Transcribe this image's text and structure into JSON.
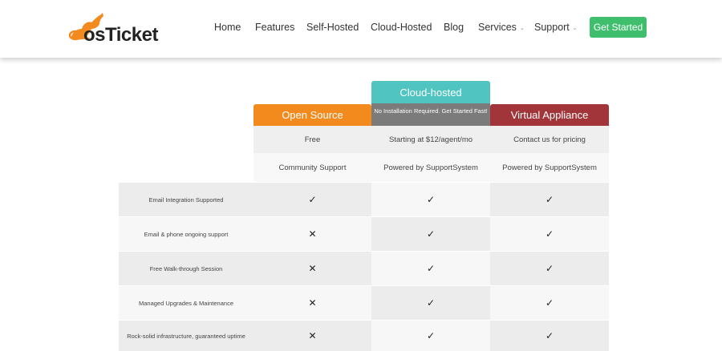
{
  "header": {
    "logo_text": "osTicket",
    "nav": [
      {
        "label": "Home"
      },
      {
        "label": "Features"
      },
      {
        "label": "Self-Hosted"
      },
      {
        "label": "Cloud-Hosted"
      },
      {
        "label": "Blog"
      },
      {
        "label": "Services",
        "dropdown": true
      },
      {
        "label": "Support",
        "dropdown": true
      }
    ],
    "cta_label": "Get Started"
  },
  "pricing": {
    "columns": [
      {
        "title": "Open Source",
        "price": "Free",
        "support": "Community Support",
        "color": "#f28a1e"
      },
      {
        "title": "Cloud-hosted",
        "subtitle": "No Installation Required. Get Started Fast!",
        "price": "Starting at $12/agent/mo",
        "support": "Powered by SupportSystem",
        "color": "#4fc4c0"
      },
      {
        "title": "Virtual Appliance",
        "price": "Contact us for pricing",
        "support": "Powered by SupportSystem",
        "color": "#a1353a"
      }
    ],
    "features": [
      {
        "label": "Email Integration Supported",
        "values": [
          "✓",
          "✓",
          "✓"
        ]
      },
      {
        "label": "Email & phone ongoing support",
        "values": [
          "✕",
          "✓",
          "✓"
        ]
      },
      {
        "label": "Free Walk-through Session",
        "values": [
          "✕",
          "✓",
          "✓"
        ]
      },
      {
        "label": "Managed Upgrades & Maintenance",
        "values": [
          "✕",
          "✓",
          "✓"
        ]
      },
      {
        "label": "Rock-solid infrastructure, guaranteed uptime",
        "values": [
          "✕",
          "✓",
          "✓"
        ]
      }
    ]
  },
  "colors": {
    "cta": "#3fbf6e",
    "cloud_sub": "#7b7b7b"
  }
}
